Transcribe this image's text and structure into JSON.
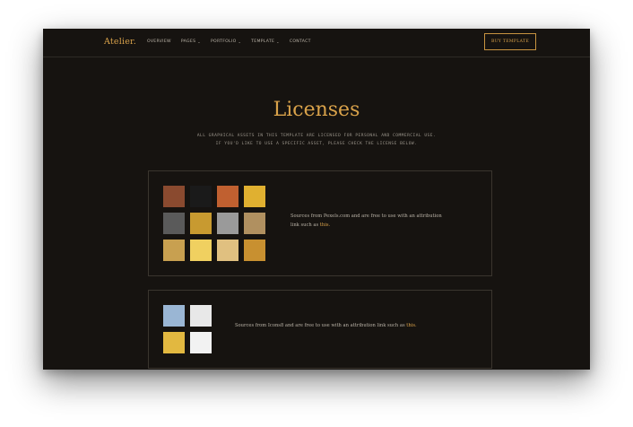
{
  "nav": {
    "logo": "Atelier.",
    "items": [
      {
        "label": "OVERVIEW",
        "dropdown": false
      },
      {
        "label": "PAGES",
        "dropdown": true
      },
      {
        "label": "PORTFOLIO",
        "dropdown": true
      },
      {
        "label": "TEMPLATE",
        "dropdown": true
      },
      {
        "label": "CONTACT",
        "dropdown": false
      }
    ],
    "cta_label": "BUY TEMPLATE"
  },
  "hero": {
    "title": "Licenses",
    "subtitle_line1": "ALL GRAPHICAL ASSETS IN THIS TEMPLATE ARE LICENSED FOR PERSONAL AND COMMERCIAL USE.",
    "subtitle_line2": "IF YOU'D LIKE TO USE A SPECIFIC ASSET, PLEASE CHECK THE LICENSE BELOW."
  },
  "licenses": [
    {
      "text_line1": "Sources from Pexels.com and are free to use with an attribution",
      "text_line2_prefix": "link such as ",
      "link_label": "this.",
      "thumbnails": [
        {
          "name": "portrait-woman-curly-hair",
          "color": "#8a4a2f"
        },
        {
          "name": "black-sunglasses",
          "color": "#1a1a1a"
        },
        {
          "name": "woman-red-sofa",
          "color": "#c06030"
        },
        {
          "name": "woman-yellow-shirt",
          "color": "#e0b030"
        },
        {
          "name": "office-desk",
          "color": "#5a5a5a"
        },
        {
          "name": "woman-yellow-dark",
          "color": "#c89a30"
        },
        {
          "name": "woman-laptop",
          "color": "#9a9a9a"
        },
        {
          "name": "woman-sitting",
          "color": "#b09060"
        },
        {
          "name": "man-blue-jacket",
          "color": "#c8a050"
        },
        {
          "name": "yellow-flowers",
          "color": "#f0d060"
        },
        {
          "name": "beach-sand",
          "color": "#e0c080"
        },
        {
          "name": "wheat-field",
          "color": "#c89030"
        }
      ]
    },
    {
      "text_line1": "Sources from Icons8 and are free to use with an attribution link such as ",
      "link_label": "this.",
      "thumbnails": [
        {
          "name": "man-blue-shirt",
          "color": "#9ab6d4"
        },
        {
          "name": "man-white-shirt",
          "color": "#e8e8e8"
        },
        {
          "name": "woman-yellow-top",
          "color": "#e2b840"
        },
        {
          "name": "woman-sunglasses-white",
          "color": "#f2f2f2"
        }
      ]
    }
  ]
}
